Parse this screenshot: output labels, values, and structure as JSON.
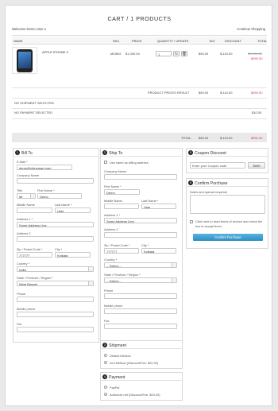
{
  "page": {
    "title": "CART / 1 PRODUCTS",
    "welcome": "Welcome Demo User ▾",
    "continue": "Continue Shopping"
  },
  "table": {
    "headers": {
      "name": "NAME",
      "sku": "SKU",
      "price": "PRICE:",
      "qty": "QUANTITY / UPDATE",
      "tax": "TAX",
      "discount": "DISCOUNT",
      "total": "TOTAL"
    },
    "product": {
      "name": "APPLE IPHONE 5",
      "sku": "MOB02",
      "price": "$1,000.00",
      "qty": "1",
      "tax": "$90.00",
      "discount": "$-110.00",
      "total_old": "$1,100.00",
      "total_new": "$990.00"
    },
    "result": {
      "label": "PRODUCT PRICES RESULT",
      "tax": "$90.00",
      "discount": "$-110.00",
      "total": "$990.00"
    },
    "shipment": {
      "label": "NO SHIPMENT SELECTED"
    },
    "payment": {
      "label": "NO PAYMENT SELECTED",
      "total": "$10.00"
    },
    "grand": {
      "label": "TOTAL:",
      "tax": "$90.00",
      "discount": "$-110.00",
      "total": "$990.00"
    }
  },
  "bill": {
    "num": "1",
    "title": "Bill To",
    "email_label": "E-Mail *",
    "email": "demo@virtuemart.com",
    "company_label": "Company Name",
    "title_label": "Title",
    "title_val": "Mr",
    "first_label": "First Name *",
    "first": "Demo",
    "middle_label": "Middle Name",
    "last_label": "Last Name *",
    "last": "User",
    "addr1_label": "Address 1 *",
    "addr1": "Some Address Line",
    "addr2_label": "Address 2",
    "zip_label": "Zip / Postal Code *",
    "zip": "777777",
    "city_label": "City *",
    "city": "Kolkata",
    "country_label": "Country *",
    "country": "India",
    "state_label": "State / Province / Region *",
    "state": "West Bengal",
    "phone_label": "Phone",
    "mobile_label": "Mobile phone",
    "fax_label": "Fax"
  },
  "ship": {
    "num": "2",
    "title": "Ship To",
    "same_label": "Use same as billing address",
    "company_label": "Company Name",
    "first_label": "First Name *",
    "first": "Demo",
    "middle_label": "Middle Name",
    "last_label": "Last Name *",
    "last": "User",
    "addr1_label": "Address 1 *",
    "addr1": "Some Address Line",
    "addr2_label": "Address 2",
    "zip_label": "Zip / Postal Code *",
    "zip": "777777",
    "city_label": "City *",
    "city": "Kolkata",
    "country_label": "Country *",
    "country": "-- Select --",
    "state_label": "State / Province / Region *",
    "state": "-- Select --",
    "phone_label": "Phone",
    "mobile_label": "Mobile phone",
    "fax_label": "Fax"
  },
  "shipment": {
    "num": "3",
    "title": "Shipment",
    "opt1": "Default Method",
    "opt2": "2nd Method (Discount/Fee: $20.00)"
  },
  "payment": {
    "num": "4",
    "title": "Payment",
    "opt1": "PayPal",
    "opt2": "Authorize.net (Discount/Fee: $10.00)"
  },
  "coupon": {
    "num": "5",
    "title": "Coupon Discount",
    "placeholder": "Enter your Coupon code",
    "save": "Save"
  },
  "confirm": {
    "num": "6",
    "title": "Confirm Purchase",
    "notes_label": "Notes and special requests",
    "terms": "Click here to read terms of service and check the box to accept them.",
    "button": "Confirm Purchase"
  },
  "colors": {
    "accent": "#2d8fc4",
    "red": "#d43a3a"
  }
}
